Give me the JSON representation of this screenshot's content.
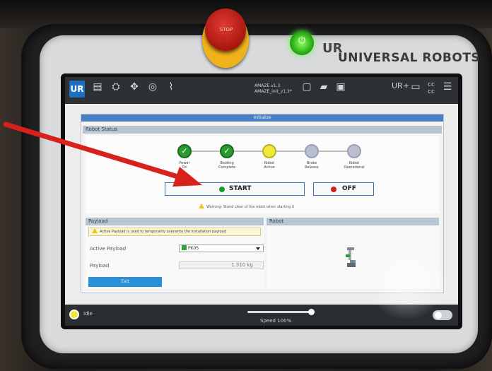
{
  "hardware": {
    "estop_label": "STOP",
    "brand_logo": "UR",
    "brand_name": "UNIVERSAL ROBOTS",
    "accent_estop": "#c21f18",
    "accent_power": "#2fb51a"
  },
  "topbar": {
    "logo": "UR",
    "program": {
      "line1": "AMAZE v1.3",
      "line2": "AMAZE_init_v1.3*"
    },
    "icons": [
      "run-icon",
      "program-icon",
      "installation-icon",
      "move-icon",
      "io-icon",
      "log-icon",
      "new-icon",
      "open-icon",
      "save-icon",
      "ur-plus-icon",
      "remote-icon",
      "cc-icon",
      "menu-icon"
    ]
  },
  "screen": {
    "title": "Initialize",
    "robot_status": {
      "header": "Robot Status",
      "steps": [
        {
          "label": "Power\nOn",
          "state": "done"
        },
        {
          "label": "Booting\nComplete",
          "state": "done"
        },
        {
          "label": "Robot\nActive",
          "state": "active"
        },
        {
          "label": "Brake\nRelease",
          "state": "pending"
        },
        {
          "label": "Robot\nOperational",
          "state": "pending"
        }
      ],
      "start_label": "START",
      "off_label": "OFF",
      "warning": "Warning: Stand clear of the robot when starting it"
    },
    "payload": {
      "header": "Payload",
      "warning": "Active Payload is used to temporarily overwrite the installation payload",
      "active_label": "Active Payload",
      "active_value": "PK05",
      "payload_label": "Payload",
      "payload_value": "1.310",
      "payload_unit": "kg"
    },
    "robot": {
      "header": "Robot"
    },
    "exit_label": "Exit"
  },
  "footer": {
    "status": "Idle",
    "speed": "Speed 100%",
    "speed_fraction": 1.0
  }
}
